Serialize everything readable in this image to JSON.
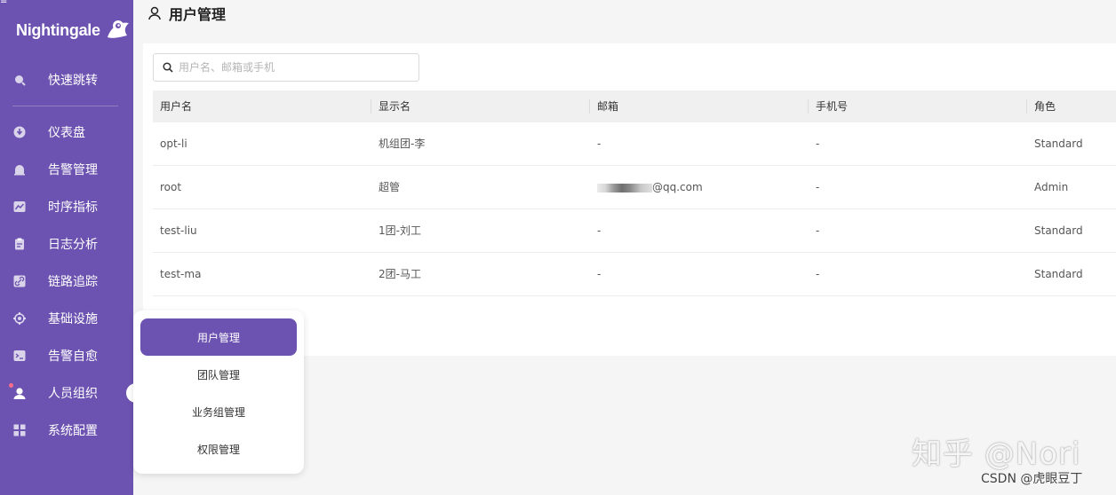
{
  "app": {
    "name": "Nightingale"
  },
  "sidebar": {
    "items": [
      {
        "label": "快速跳转",
        "icon": "search-icon"
      },
      {
        "label": "仪表盘",
        "icon": "dashboard-icon"
      },
      {
        "label": "告警管理",
        "icon": "alarm-bell-icon"
      },
      {
        "label": "时序指标",
        "icon": "line-chart-icon"
      },
      {
        "label": "日志分析",
        "icon": "clipboard-icon"
      },
      {
        "label": "链路追踪",
        "icon": "link-icon"
      },
      {
        "label": "基础设施",
        "icon": "target-icon"
      },
      {
        "label": "告警自愈",
        "icon": "terminal-icon"
      },
      {
        "label": "人员组织",
        "icon": "user-icon"
      },
      {
        "label": "系统配置",
        "icon": "grid-icon"
      }
    ]
  },
  "submenu": {
    "items": [
      {
        "label": "用户管理",
        "active": true
      },
      {
        "label": "团队管理"
      },
      {
        "label": "业务组管理"
      },
      {
        "label": "权限管理"
      }
    ]
  },
  "header": {
    "title": "用户管理"
  },
  "search": {
    "placeholder": "用户名、邮箱或手机"
  },
  "table": {
    "columns": [
      "用户名",
      "显示名",
      "邮箱",
      "手机号",
      "角色"
    ],
    "rows": [
      {
        "username": "opt-li",
        "display": "机组团-李",
        "email": "-",
        "phone": "-",
        "role": "Standard"
      },
      {
        "username": "root",
        "display": "超管",
        "email": "@qq.com",
        "phone": "-",
        "role": "Admin"
      },
      {
        "username": "test-liu",
        "display": "1团-刘工",
        "email": "-",
        "phone": "-",
        "role": "Standard"
      },
      {
        "username": "test-ma",
        "display": "2团-马工",
        "email": "-",
        "phone": "-",
        "role": "Standard"
      }
    ]
  },
  "watermark": {
    "zhihu": "知乎 @Nori",
    "csdn": "CSDN @虎眼豆丁"
  },
  "colors": {
    "sidebar": "#6c53b1",
    "accent": "#6c53b1",
    "background": "#f5f5f5"
  }
}
